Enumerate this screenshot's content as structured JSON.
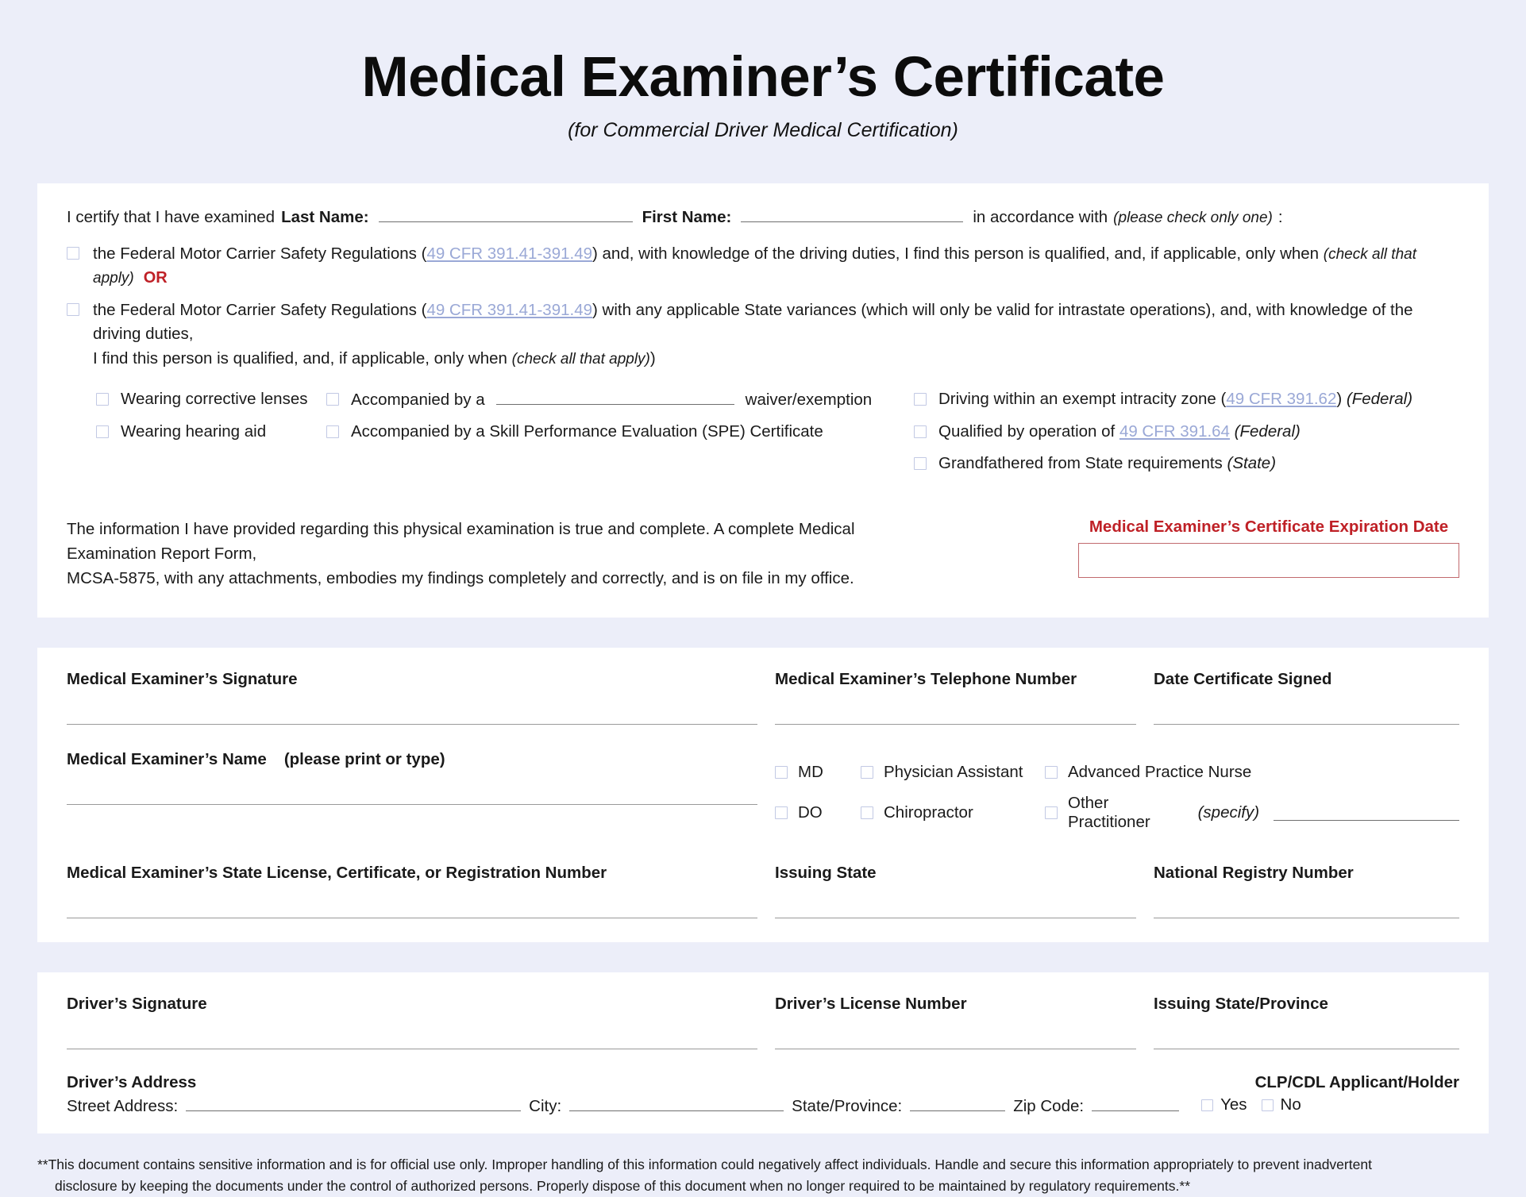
{
  "header": {
    "title": "Medical Examiner’s Certificate",
    "subtitle": "(for Commercial Driver Medical Certification)"
  },
  "colors": {
    "page_background": "#eceef9",
    "panel_background": "#ffffff",
    "accent_red": "#bf2026",
    "link_blue": "#9aa8d6",
    "checkbox_border": "#c2c9e4",
    "rule_gray": "#9a9a9a"
  },
  "certify": {
    "lead_text": "I certify that I have examined",
    "last_name_label": "Last Name:",
    "last_name_value": "",
    "first_name_label": "First Name:",
    "first_name_value": "",
    "accordance_text": "in accordance with",
    "accordance_note": "(please check only one)",
    "accordance_colon": ":",
    "options": [
      {
        "pre": "the Federal Motor Carrier Safety Regulations (",
        "link": "49 CFR 391.41-391.49",
        "post": ") and, with knowledge of the driving duties, I find this person is qualified, and, if applicable, only when",
        "note": "(check all that apply)",
        "trailer": "OR"
      },
      {
        "pre": "the Federal Motor Carrier Safety Regulations (",
        "link": "49 CFR 391.41-391.49",
        "post": ") with any applicable State variances (which will only be valid for intrastate operations), and, with knowledge of the driving duties,",
        "line2_pre": "I find this person is qualified, and, if applicable, only when",
        "note": "(check all that apply)",
        "line2_post": ")"
      }
    ],
    "conditions": {
      "corrective_lenses": "Wearing corrective lenses",
      "hearing_aid": "Wearing hearing aid",
      "accompanied_by_a": "Accompanied by a",
      "waiver_exemption": "waiver/exemption",
      "waiver_value": "",
      "spe_certificate": "Accompanied by a Skill Performance Evaluation (SPE) Certificate",
      "exempt_intracity_pre": "Driving within an exempt intracity zone (",
      "exempt_intracity_link": "49 CFR 391.62",
      "exempt_intracity_post": ")",
      "exempt_intracity_scope": "(Federal)",
      "qualified_by_pre": "Qualified by operation of",
      "qualified_by_link": "49 CFR 391.64",
      "qualified_by_scope": "(Federal)",
      "grandfathered": "Grandfathered from State requirements",
      "grandfathered_scope": "(State)"
    },
    "attestation_line1": "The information I have provided regarding this physical examination is true and complete. A complete Medical Examination Report Form,",
    "attestation_line2": "MCSA-5875, with any attachments, embodies my findings completely and correctly, and is on file in my office.",
    "expiration_label": "Medical Examiner’s Certificate Expiration Date",
    "expiration_value": ""
  },
  "examiner": {
    "signature_label": "Medical Examiner’s Signature",
    "signature_value": "",
    "telephone_label": "Medical Examiner’s Telephone Number",
    "telephone_value": "",
    "date_signed_label": "Date Certificate Signed",
    "date_signed_value": "",
    "name_label": "Medical Examiner’s Name",
    "name_note": "(please print or type)",
    "name_value": "",
    "license_label": "Medical Examiner’s State License, Certificate, or Registration Number",
    "license_value": "",
    "issuing_state_label": "Issuing State",
    "issuing_state_value": "",
    "national_registry_label": "National Registry Number",
    "national_registry_value": "",
    "practitioner_types": [
      {
        "label": "MD"
      },
      {
        "label": "Physician Assistant"
      },
      {
        "label": "Advanced Practice Nurse"
      },
      {
        "label": "DO"
      },
      {
        "label": "Chiropractor"
      },
      {
        "label": "Other Practitioner"
      }
    ],
    "other_practitioner_note": "(specify)",
    "other_practitioner_value": ""
  },
  "driver": {
    "signature_label": "Driver’s Signature",
    "signature_value": "",
    "license_number_label": "Driver’s License Number",
    "license_number_value": "",
    "issuing_state_label": "Issuing State/Province",
    "issuing_state_value": "",
    "address_label": "Driver’s Address",
    "street_label": "Street Address:",
    "street_value": "",
    "city_label": "City:",
    "city_value": "",
    "state_label": "State/Province:",
    "state_value": "",
    "zip_label": "Zip Code:",
    "zip_value": "",
    "clp_label": "CLP/CDL Applicant/Holder",
    "clp_yes": "Yes",
    "clp_no": "No"
  },
  "footer": {
    "line1": "**This document contains sensitive information and is for official use only. Improper handling of this information could negatively affect individuals. Handle and secure this information appropriately to prevent inadvertent",
    "line2": "disclosure by keeping the documents under the control of authorized persons. Properly dispose of this document when no longer required to be maintained by regulatory requirements.**"
  }
}
